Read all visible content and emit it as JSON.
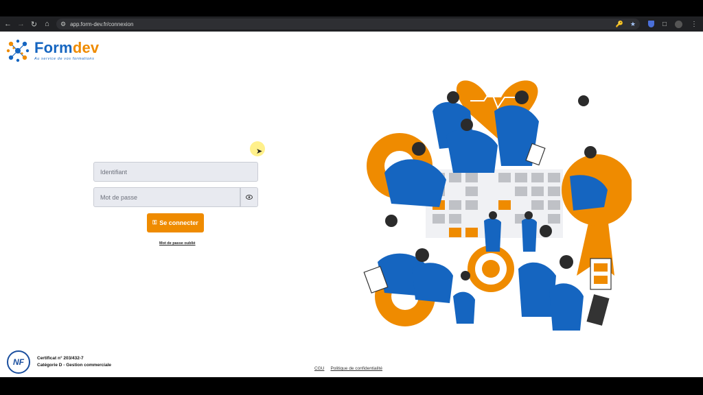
{
  "browser": {
    "url": "app.form-dev.fr/connexion",
    "icons": [
      "back-icon",
      "forward-icon",
      "reload-icon",
      "home-icon",
      "site-settings-icon",
      "key-icon",
      "star-icon",
      "extension-icon",
      "menu-icon"
    ]
  },
  "brand": {
    "name_part1": "Form",
    "name_part2": "dev",
    "tagline": "Au service de vos formations",
    "primary_color": "#1565c0",
    "accent_color": "#ef8b00"
  },
  "login": {
    "username_placeholder": "Identifiant",
    "password_placeholder": "Mot de passe",
    "submit_label": "Se connecter",
    "forgot_label": "Mot de passe oublié"
  },
  "certification": {
    "badge": "NF",
    "line1": "Certificat n° 203/432-7",
    "line2": "Catégorie D - Gestion commerciale"
  },
  "footer": {
    "cgu": "CGU",
    "privacy": "Politique de confidentialité"
  }
}
